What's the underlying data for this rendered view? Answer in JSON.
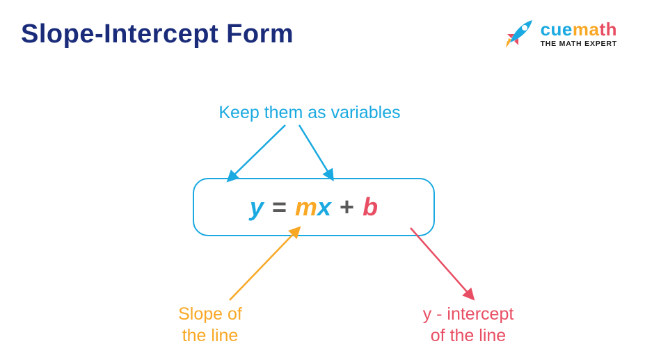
{
  "title": "Slope-Intercept Form",
  "logo": {
    "brand_cue": "cue",
    "brand_ma": "ma",
    "brand_th": "th",
    "tagline": "THE MATH EXPERT"
  },
  "labels": {
    "variables": "Keep them as variables",
    "slope": "Slope of\nthe line",
    "intercept": "y - intercept\nof the line"
  },
  "equation": {
    "y": "y",
    "eq": "=",
    "m": "m",
    "x": "x",
    "plus": "+",
    "b": "b"
  },
  "colors": {
    "blue": "#1aa9e0",
    "orange": "#f9a825",
    "pink": "#e84e63",
    "navy": "#1a2b7a"
  }
}
